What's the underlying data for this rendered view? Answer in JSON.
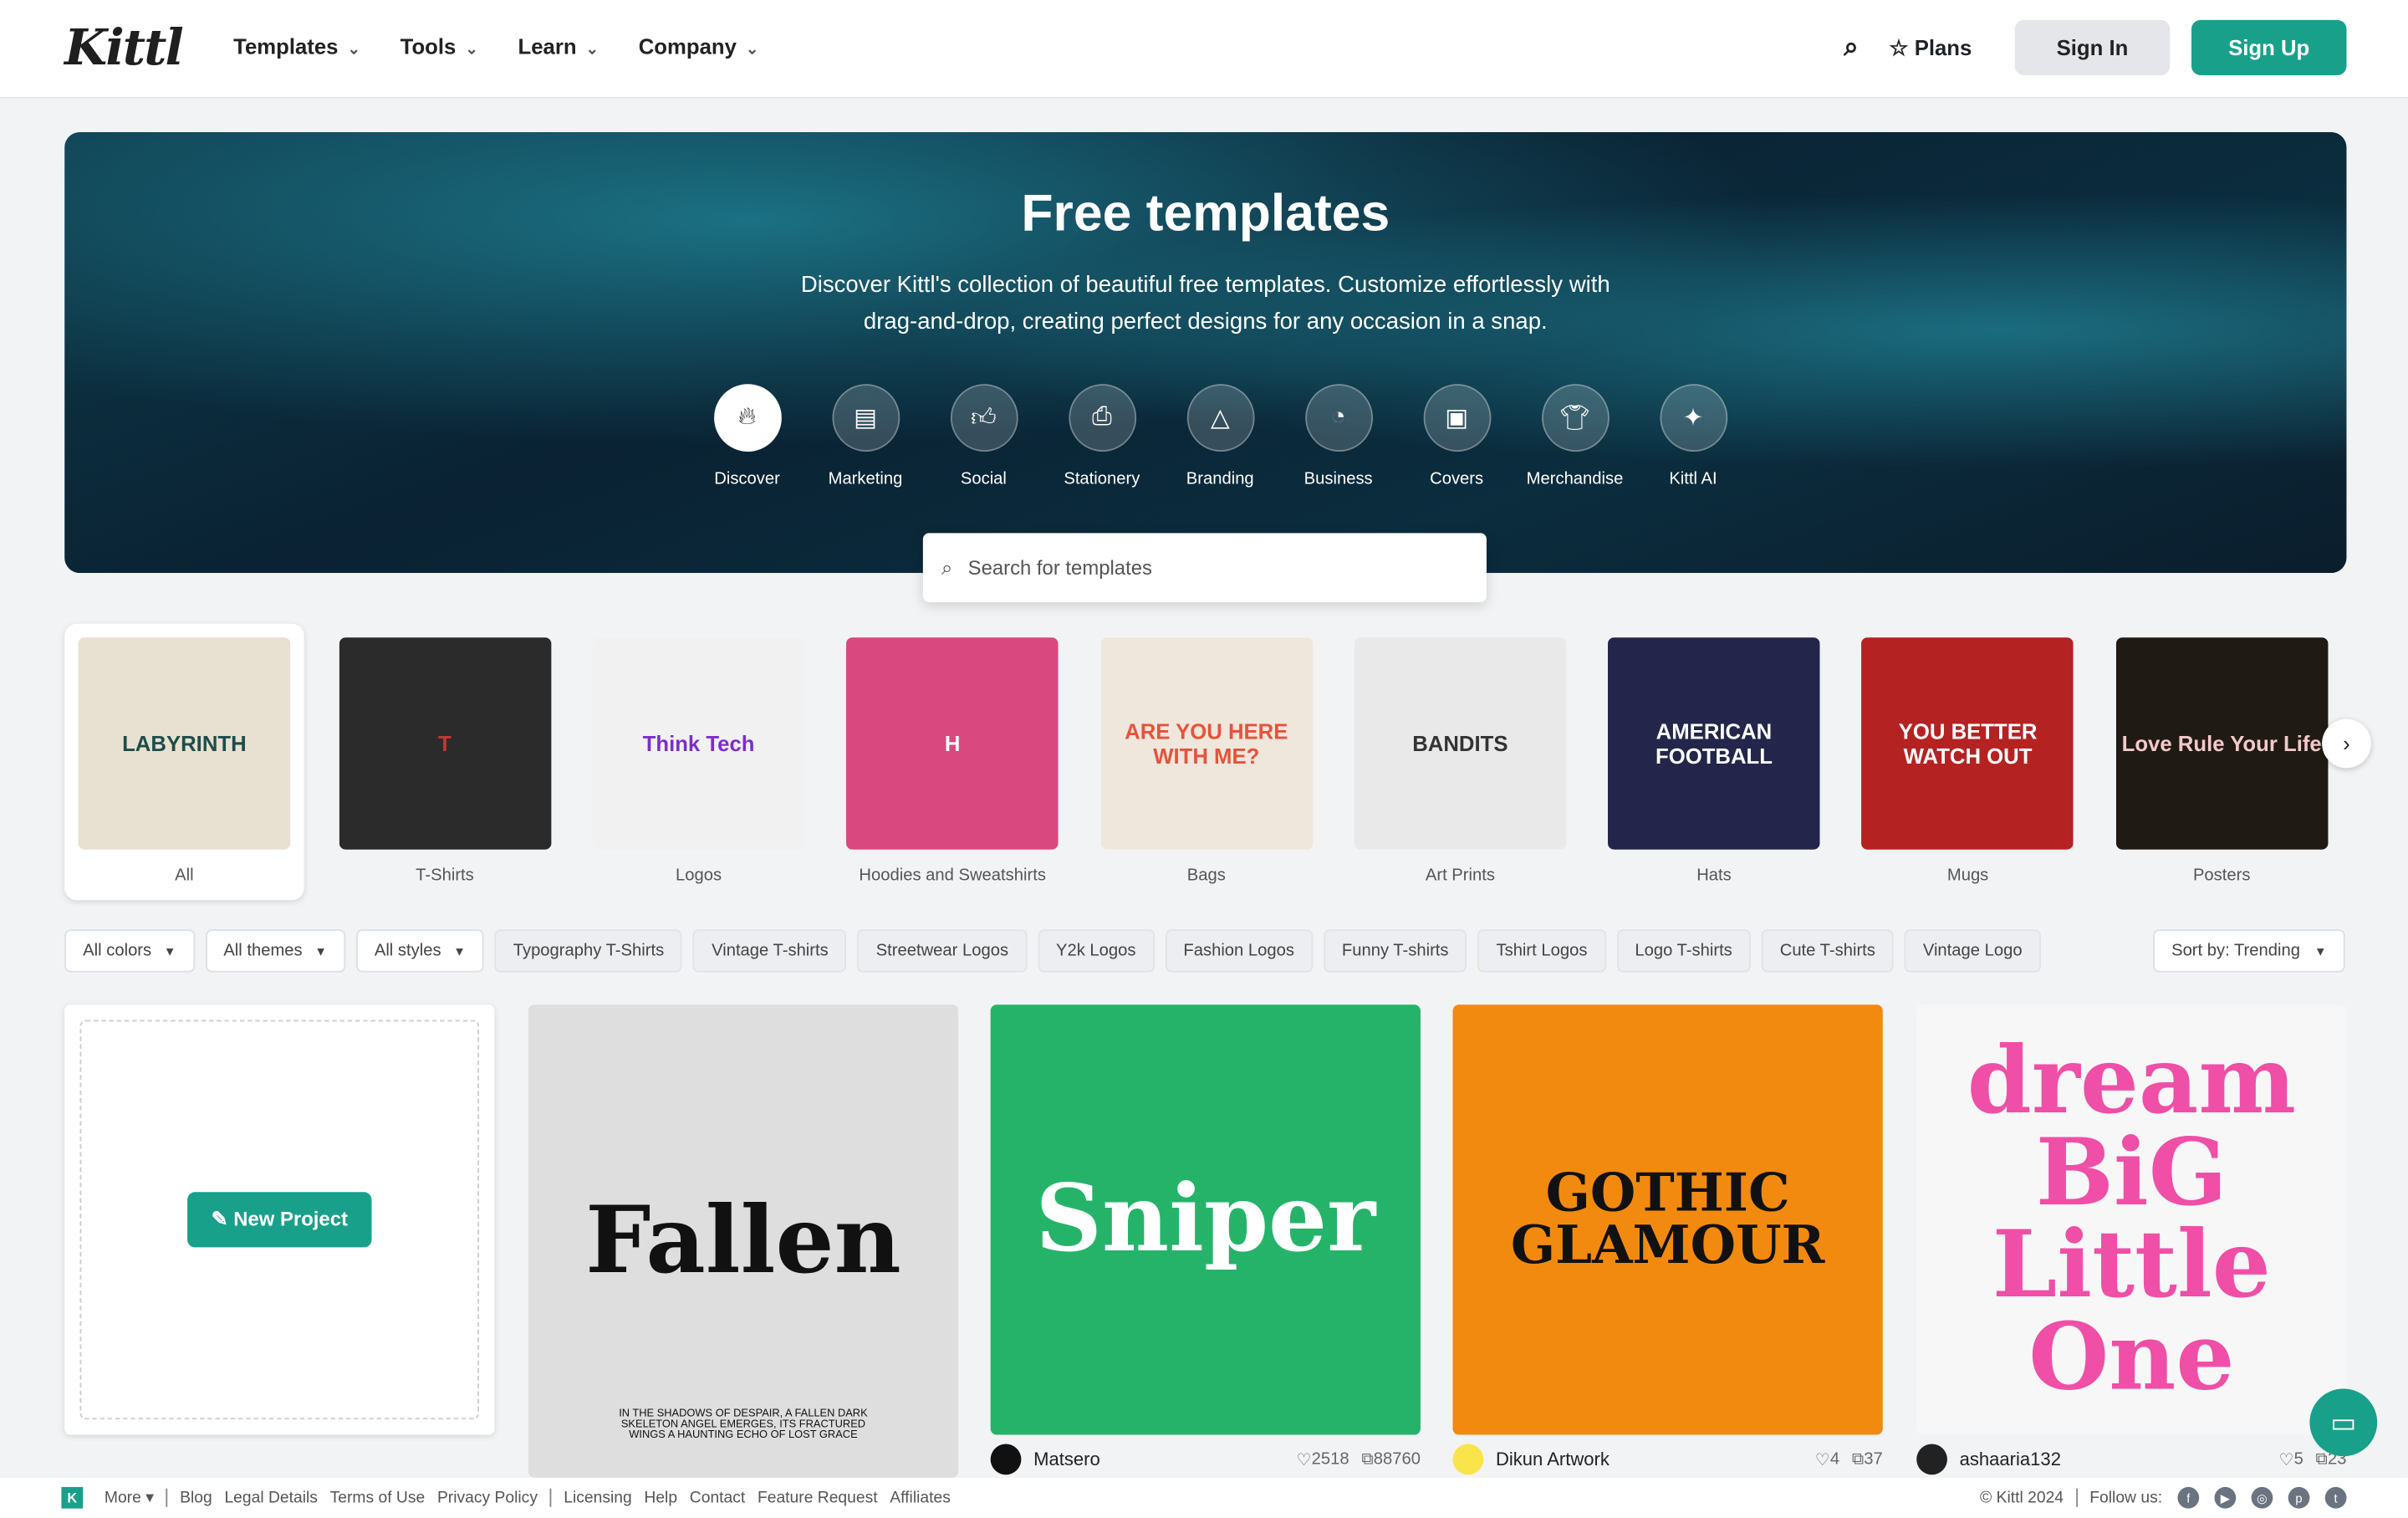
{
  "header": {
    "logo": "Kittl",
    "nav": [
      "Templates",
      "Tools",
      "Learn",
      "Company"
    ],
    "plans": "Plans",
    "sign_in": "Sign In",
    "sign_up": "Sign Up"
  },
  "hero": {
    "title": "Free templates",
    "subtitle": "Discover Kittl's collection of beautiful free templates. Customize effortlessly with drag-and-drop, creating perfect designs for any occasion in a snap.",
    "categories": [
      {
        "label": "Discover",
        "icon": "flame"
      },
      {
        "label": "Marketing",
        "icon": "document"
      },
      {
        "label": "Social",
        "icon": "thumbs-up"
      },
      {
        "label": "Stationery",
        "icon": "printer"
      },
      {
        "label": "Branding",
        "icon": "shapes"
      },
      {
        "label": "Business",
        "icon": "pie-chart"
      },
      {
        "label": "Covers",
        "icon": "image-book"
      },
      {
        "label": "Merchandise",
        "icon": "t-shirt"
      },
      {
        "label": "Kittl AI",
        "icon": "sparkle"
      }
    ],
    "search_placeholder": "Search for templates"
  },
  "products": [
    {
      "label": "All",
      "art": "LABYRINTH"
    },
    {
      "label": "T-Shirts",
      "art": "T"
    },
    {
      "label": "Logos",
      "art": "Think Tech"
    },
    {
      "label": "Hoodies and Sweatshirts",
      "art": "H"
    },
    {
      "label": "Bags",
      "art": "ARE YOU HERE WITH ME?"
    },
    {
      "label": "Art Prints",
      "art": "BANDITS"
    },
    {
      "label": "Hats",
      "art": "AMERICAN FOOTBALL"
    },
    {
      "label": "Mugs",
      "art": "YOU BETTER WATCH OUT"
    },
    {
      "label": "Posters",
      "art": "Love Rule Your Life"
    }
  ],
  "filters": {
    "dropdowns": [
      "All colors",
      "All themes",
      "All styles"
    ],
    "tags": [
      "Typography T-Shirts",
      "Vintage T-shirts",
      "Streetwear Logos",
      "Y2k Logos",
      "Fashion Logos",
      "Funny T-shirts",
      "Tshirt Logos",
      "Logo T-shirts",
      "Cute T-shirts",
      "Vintage Logo"
    ],
    "sort": "Sort by: Trending"
  },
  "new_project": "New Project",
  "templates": [
    {
      "art": "Fallen",
      "caption": "IN THE SHADOWS OF DESPAIR, A FALLEN DARK SKELETON ANGEL EMERGES, ITS FRACTURED WINGS A HAUNTING ECHO OF LOST GRACE",
      "bg": "#dedede",
      "fg": "#111"
    },
    {
      "art": "Sniper",
      "bg": "#25b36a",
      "fg": "#fff",
      "author": "Matsero",
      "likes": "2518",
      "copies": "88760"
    },
    {
      "art": "GOTHIC GLAMOUR",
      "bg": "#f28a0f",
      "fg": "#111",
      "author": "Dikun Artwork",
      "likes": "4",
      "copies": "37"
    },
    {
      "art": "dream BiG Little One",
      "bg": "#f7f7f7",
      "fg": "#ef4fa6",
      "author": "ashaaria132",
      "likes": "5",
      "copies": "23"
    }
  ],
  "footer": {
    "more": "More",
    "links1": [
      "Blog",
      "Legal Details",
      "Terms of Use",
      "Privacy Policy"
    ],
    "links2": [
      "Licensing",
      "Help",
      "Contact",
      "Feature Request",
      "Affiliates"
    ],
    "copyright": "© Kittl 2024",
    "follow": "Follow us:",
    "social": [
      "facebook",
      "youtube",
      "instagram",
      "pinterest",
      "twitter"
    ]
  }
}
